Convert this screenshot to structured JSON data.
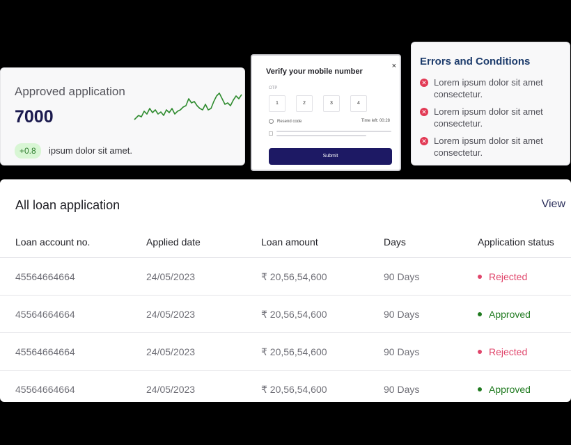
{
  "approved": {
    "title": "Approved application",
    "value": "7000",
    "delta": "+0.8",
    "caption": "ipsum dolor sit amet."
  },
  "otp": {
    "title": "Verify your mobile number",
    "close": "×",
    "label": "OTP",
    "digits": [
      "1",
      "2",
      "3",
      "4"
    ],
    "resend": "Resend code",
    "timer": "Time left: 00:28",
    "submit": "Submit"
  },
  "errors": {
    "title": "Errors and Conditions",
    "items": [
      "Lorem ipsum dolor sit amet consectetur.",
      "Lorem ipsum dolor sit amet consectetur.",
      "Lorem ipsum dolor sit amet consectetur."
    ]
  },
  "loans": {
    "title": "All loan application",
    "view": "View",
    "headers": [
      "Loan account no.",
      "Applied date",
      "Loan amount",
      "Days",
      "Application status"
    ],
    "rows": [
      {
        "account": "45564664664",
        "date": "24/05/2023",
        "amount": "₹ 20,56,54,600",
        "days": "90 Days",
        "status": "Rejected"
      },
      {
        "account": "45564664664",
        "date": "24/05/2023",
        "amount": "₹ 20,56,54,600",
        "days": "90 Days",
        "status": "Approved"
      },
      {
        "account": "45564664664",
        "date": "24/05/2023",
        "amount": "₹ 20,56,54,600",
        "days": "90 Days",
        "status": "Rejected"
      },
      {
        "account": "45564664664",
        "date": "24/05/2023",
        "amount": "₹ 20,56,54,600",
        "days": "90 Days",
        "status": "Approved"
      }
    ]
  },
  "colors": {
    "rejected": "#e0456b",
    "approved": "#1f7a1f",
    "sparkline": "#2e8b2e"
  }
}
